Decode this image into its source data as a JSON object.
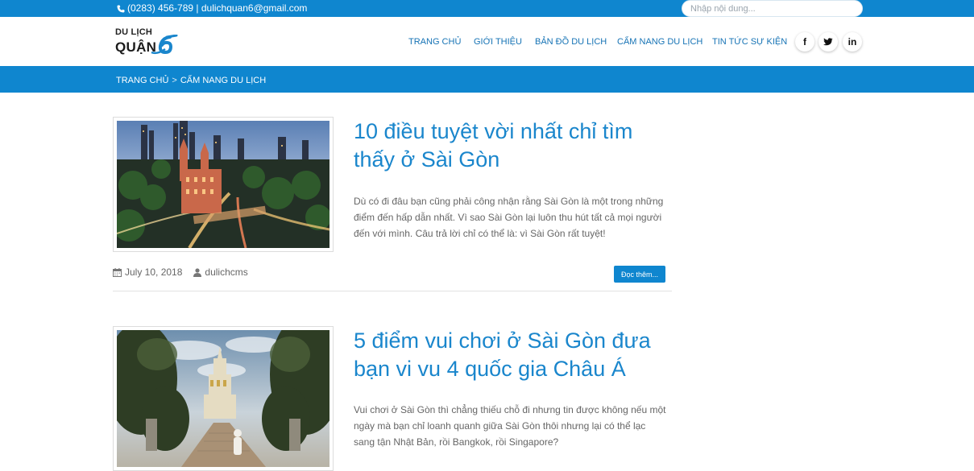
{
  "topbar": {
    "contact": "(0283) 456-789 | dulichquan6@gmail.com",
    "search_placeholder": "Nhập nội dung..."
  },
  "logo": {
    "line1": "DU LỊCH",
    "line2": "QUẬN",
    "number": "6"
  },
  "nav": {
    "items": [
      {
        "label": "TRANG CHỦ"
      },
      {
        "label": "GIỚI THIỆU"
      },
      {
        "label": "BẢN ĐỒ DU LỊCH"
      },
      {
        "label": "CẨM NANG DU LỊCH"
      },
      {
        "label": "TIN TỨC SỰ KIỆN"
      }
    ]
  },
  "social": {
    "facebook": "f",
    "twitter": "t",
    "linkedin": "in"
  },
  "breadcrumb": {
    "home": "TRANG CHỦ",
    "separator": ">",
    "current": "CẨM NANG DU LỊCH"
  },
  "posts": [
    {
      "title": "10 điều tuyệt vời nhất chỉ tìm thấy ở Sài Gòn",
      "excerpt": "Dù có đi đâu bạn cũng phải công nhận rằng Sài Gòn là một trong những điểm đến hấp dẫn nhất. Vì sao Sài Gòn lại luôn thu hút tất cả mọi người đến với mình. Câu trả lời chỉ có thể là: vì Sài Gòn rất tuyệt!",
      "date": "July 10, 2018",
      "author": "dulichcms",
      "read_more": "Đọc thêm..."
    },
    {
      "title": "5 điểm vui chơi ở Sài Gòn đưa bạn vi vu 4 quốc gia Châu Á",
      "excerpt": "Vui chơi ở Sài Gòn thì chẳng thiếu chỗ đi nhưng tin được không nếu một ngày mà bạn chỉ loanh quanh giữa Sài Gòn thôi nhưng lại có thể lạc sang tận Nhật Bản, rồi Bangkok, rồi Singapore?"
    }
  ],
  "colors": {
    "brand_blue": "#0f86cf",
    "title_blue": "#1a86cc",
    "nav_blue": "#1673b5"
  }
}
